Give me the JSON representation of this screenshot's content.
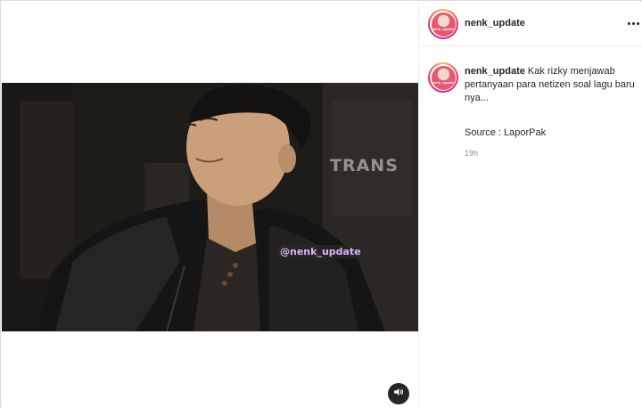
{
  "post": {
    "username": "nenk_update",
    "avatar_text": "nenk_update",
    "more_icon": "more-horizontal-icon"
  },
  "caption": {
    "username": "nenk_update",
    "text": "Kak rizky menjawab pertanyaan para netizen soal lagu baru nya...",
    "source": "Source : LaporPak",
    "time": "19h"
  },
  "media": {
    "watermark": "@nenk_update",
    "channel_logo": "TRANS",
    "sound_icon": "speaker-volume-icon"
  },
  "colors": {
    "border": "#dbdbdb",
    "text": "#262626",
    "muted": "#8e8e8e",
    "story_ring": "#f0266a"
  }
}
